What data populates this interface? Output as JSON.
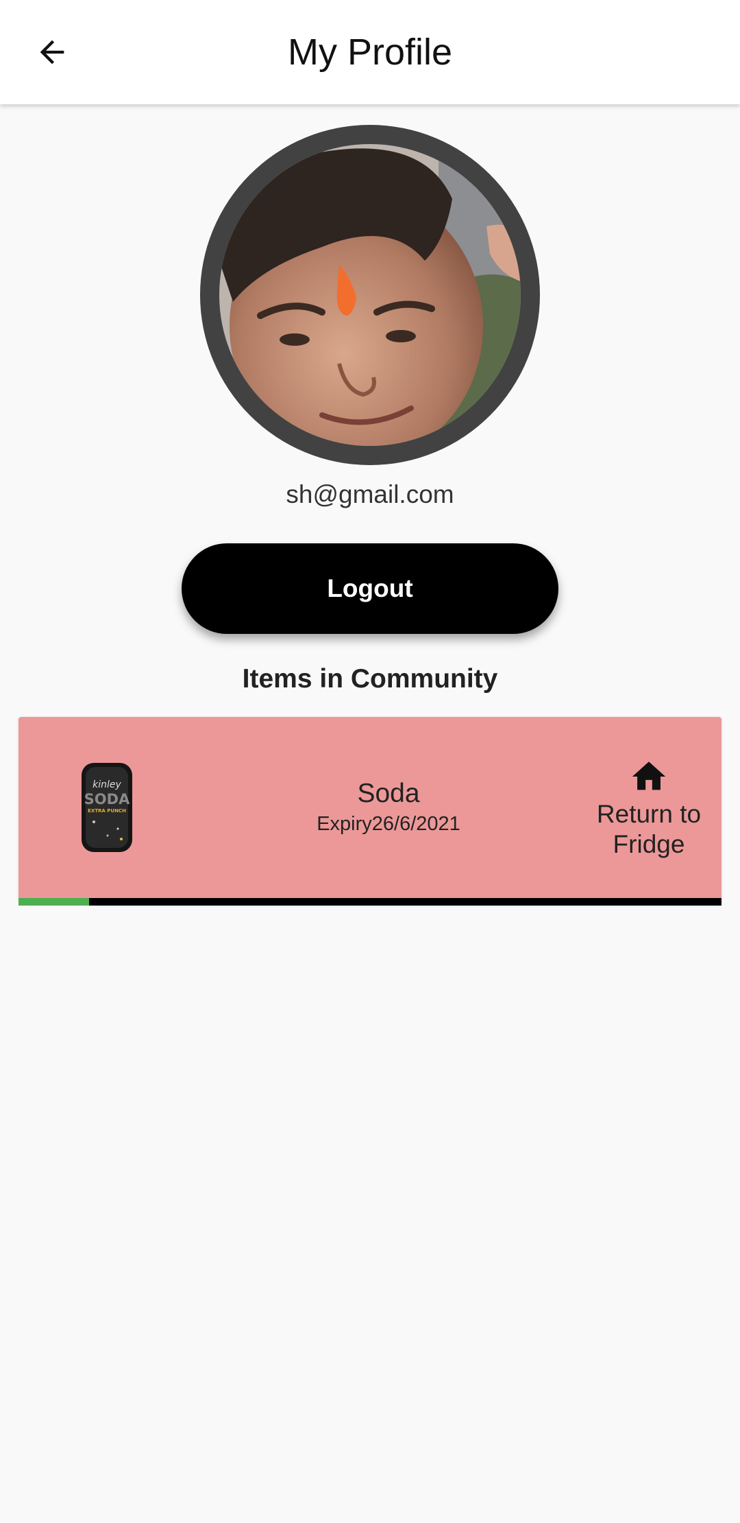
{
  "appbar": {
    "title": "My Profile",
    "back_icon": "arrow-back-icon"
  },
  "profile": {
    "email": "sh@gmail.com",
    "avatar": "profile-photo",
    "ring_color": "#424242"
  },
  "actions": {
    "logout_label": "Logout"
  },
  "community": {
    "title": "Items in Community",
    "items": [
      {
        "name": "Soda",
        "expiry": "Expiry26/6/2021",
        "image": "soda-can-image",
        "return_icon": "home-icon",
        "return_label": "Return to Fridge",
        "card_color": "#ec9898",
        "progress": 0.1,
        "progress_color": "#4caf50"
      }
    ]
  }
}
